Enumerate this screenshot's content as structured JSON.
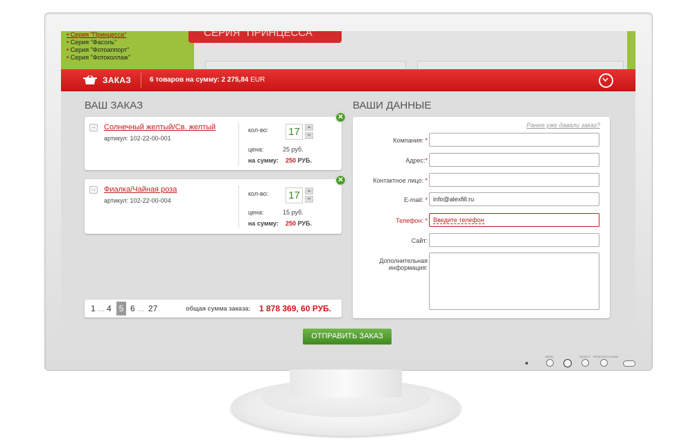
{
  "promo": {
    "series_items": [
      "Серия \"Принцесса\"",
      "Серия \"Фасоль\"",
      "Серия \"Фотоаппорт\"",
      "Серия \"Фотоколлаж\""
    ],
    "banner_title": "СЕРИЯ \"ПРИНЦЕССА\""
  },
  "order_bar": {
    "title": "ЗАКАЗ",
    "summary_prefix": "6 товаров на сумму:",
    "summary_value": "2 275,84",
    "summary_currency": "EUR"
  },
  "order": {
    "title": "ВАШ ЗАКАЗ",
    "items": [
      {
        "name": "Солнечный желтый/Св. желтый",
        "sku": "артикул: 102-22-00-001",
        "qty_label": "кол-во:",
        "qty": "17",
        "price_label": "цена:",
        "price": "25 руб.",
        "sum_label": "на сумму:",
        "sum_value": "250",
        "sum_currency": "РУБ."
      },
      {
        "name": "Фиалка/Чайная роза",
        "sku": "артикул: 102-22-00-004",
        "qty_label": "кол-во:",
        "qty": "17",
        "price_label": "цена:",
        "price": "15 руб.",
        "sum_label": "на сумму:",
        "sum_value": "250",
        "sum_currency": "РУБ."
      }
    ],
    "pagination": {
      "first": "1",
      "dots1": "...",
      "prev": "4",
      "current": "5",
      "next": "6",
      "dots2": "...",
      "last": "27"
    },
    "total_label": "общая сумма заказа:",
    "total_value": "1 878 369, 60 РУБ."
  },
  "form": {
    "title": "ВАШИ ДАННЫЕ",
    "prev_order_link": "Ранее уже давали заказ?",
    "fields": [
      {
        "label": "Компания:",
        "value": ""
      },
      {
        "label": "Адрес:",
        "value": ""
      },
      {
        "label": "Контактное лицо:",
        "value": ""
      },
      {
        "label": "E-mail:",
        "value": "info@alexfill.ru"
      },
      {
        "label": "Телефон:",
        "value": "Введите телефон"
      },
      {
        "label": "Сайт:",
        "value": ""
      }
    ],
    "extra_label_1": "Дополнительная",
    "extra_label_2": "информация:",
    "required_mark": "*"
  },
  "submit_label": "ОТПРАВИТЬ ЗАКАЗ",
  "monitor": {
    "menu_label": "MENU",
    "select_label": "SELECT",
    "reset_label": "RESET/ECO MODE"
  },
  "colors": {
    "accent_red": "#d32b2b",
    "accent_green": "#4b9d2a"
  }
}
